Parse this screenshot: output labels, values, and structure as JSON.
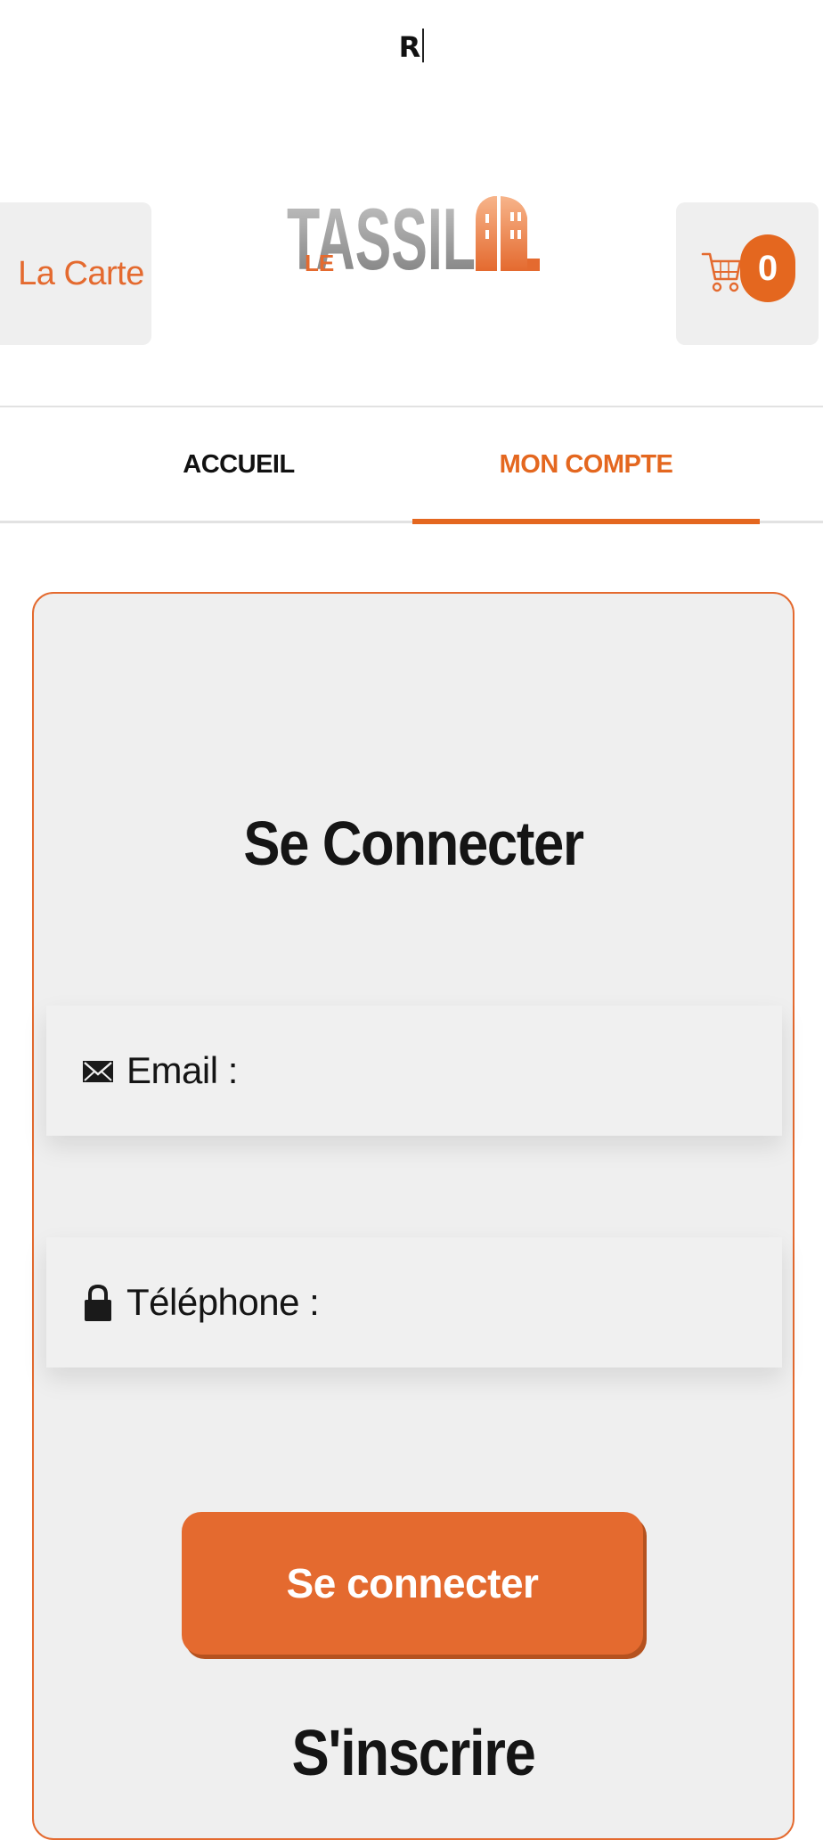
{
  "top_indicator": {
    "text": "R"
  },
  "header": {
    "menu_button_label": "La Carte",
    "logo": {
      "prefix": "LE",
      "name": "TASSIL"
    },
    "cart": {
      "icon": "cart-icon",
      "count": "0"
    }
  },
  "nav": {
    "tabs": [
      {
        "label": "ACCUEIL",
        "active": false
      },
      {
        "label": "MON COMPTE",
        "active": true
      }
    ]
  },
  "login": {
    "title": "Se Connecter",
    "email_field": {
      "icon": "envelope-icon",
      "label": "Email :"
    },
    "phone_field": {
      "icon": "lock-icon",
      "label": "Téléphone :"
    },
    "submit_label": "Se connecter",
    "register_title": "S'inscrire"
  },
  "colors": {
    "accent": "#e4671f",
    "card_background": "#efefef",
    "text": "#151515"
  }
}
